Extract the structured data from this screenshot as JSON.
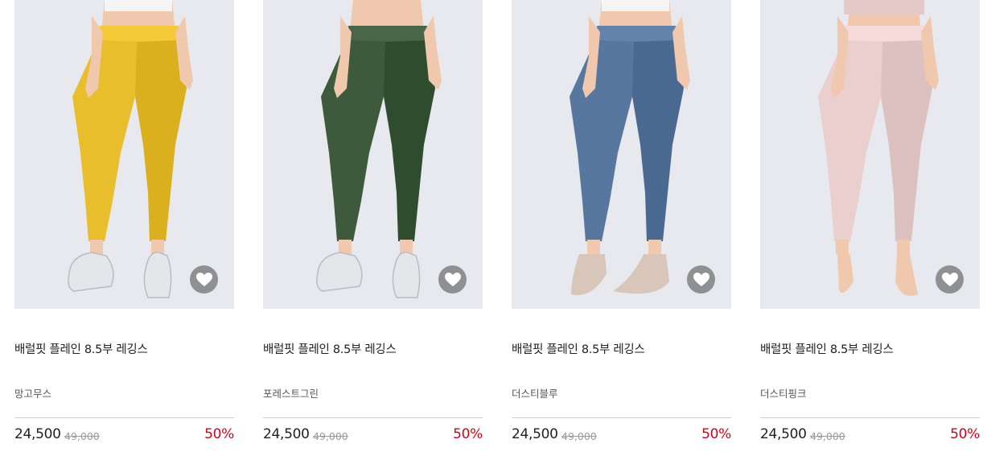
{
  "products": [
    {
      "name": "배럴핏 플레인 8.5부 레깅스",
      "color": "망고무스",
      "price": "24,500",
      "original_price": "49,000",
      "discount": "50%",
      "swatch": "#e9be2c",
      "shoe": "sneakers"
    },
    {
      "name": "배럴핏 플레인 8.5부 레깅스",
      "color": "포레스트그린",
      "price": "24,500",
      "original_price": "49,000",
      "discount": "50%",
      "swatch": "#3e5a3c",
      "shoe": "sneakers"
    },
    {
      "name": "배럴핏 플레인 8.5부 레깅스",
      "color": "더스티블루",
      "price": "24,500",
      "original_price": "49,000",
      "discount": "50%",
      "swatch": "#58779f",
      "shoe": "grip-socks"
    },
    {
      "name": "배럴핏 플레인 8.5부 레깅스",
      "color": "더스티핑크",
      "price": "24,500",
      "original_price": "49,000",
      "discount": "50%",
      "swatch": "#ebcfcf",
      "shoe": "barefoot"
    }
  ],
  "icons": {
    "wishlist": "heart-icon"
  },
  "colors": {
    "discount": "#d0021b",
    "photo_background": "#e7e9ee"
  }
}
